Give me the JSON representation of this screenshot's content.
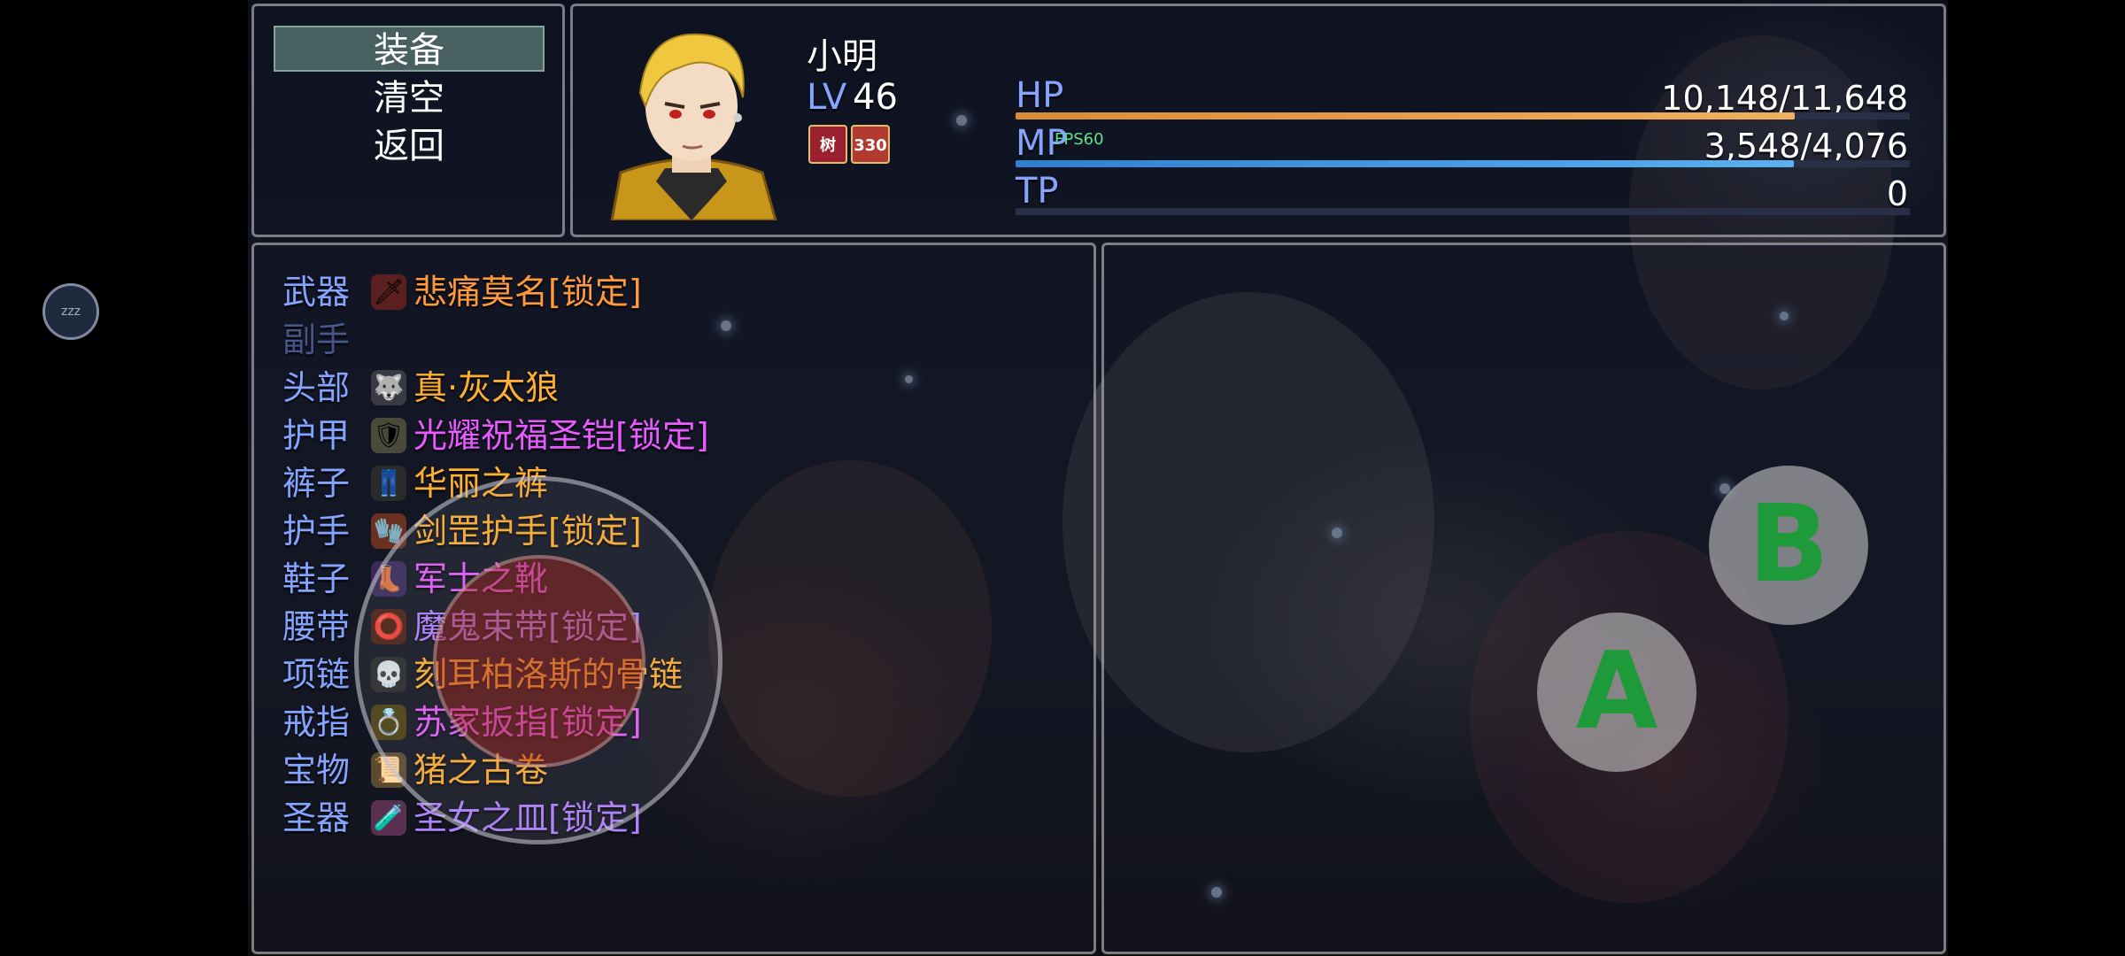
{
  "command_window": {
    "items": [
      {
        "label": "装备",
        "selected": true
      },
      {
        "label": "清空",
        "selected": false
      },
      {
        "label": "返回",
        "selected": false
      }
    ]
  },
  "actor": {
    "name": "小明",
    "level_label": "LV",
    "level": "46",
    "states": [
      {
        "text": "树",
        "icon": "stance-icon"
      },
      {
        "text": "330",
        "icon": "buff-icon"
      }
    ]
  },
  "gauges": {
    "hp": {
      "label": "HP",
      "value_text": "10,148/11,648",
      "current": 10148,
      "max": 11648,
      "color_start": "#d98a3a",
      "color_end": "#f0b060"
    },
    "mp": {
      "label": "MP",
      "value_text": "3,548/4,076",
      "current": 3548,
      "max": 4076,
      "color_start": "#2f7fd0",
      "color_end": "#5ab0f0"
    },
    "tp": {
      "label": "TP",
      "value_text": "0",
      "current": 0,
      "max": 100,
      "color_start": "#3aa060",
      "color_end": "#70d090"
    }
  },
  "fps_text": "FPS60",
  "slots": [
    {
      "label": "武器",
      "item": "悲痛莫名[锁定]",
      "item_color": "#ff9a3c",
      "icon": "sword-icon",
      "icon_glyph": "🗡",
      "icon_bg": "#5a2020",
      "empty": false
    },
    {
      "label": "副手",
      "item": "",
      "item_color": "#ffffff",
      "icon": "",
      "icon_glyph": "",
      "icon_bg": "transparent",
      "empty": true
    },
    {
      "label": "头部",
      "item": "真·灰太狼",
      "item_color": "#ffb030",
      "icon": "wolf-head-icon",
      "icon_glyph": "🐺",
      "icon_bg": "#3a3a44",
      "empty": false
    },
    {
      "label": "护甲",
      "item": "光耀祝福圣铠[锁定]",
      "item_color": "#e85cff",
      "icon": "armor-icon",
      "icon_glyph": "🛡",
      "icon_bg": "#4a4a3a",
      "empty": false
    },
    {
      "label": "裤子",
      "item": "华丽之裤",
      "item_color": "#ffb030",
      "icon": "pants-icon",
      "icon_glyph": "👖",
      "icon_bg": "#2a2a2a",
      "empty": false
    },
    {
      "label": "护手",
      "item": "剑罡护手[锁定]",
      "item_color": "#ffb030",
      "icon": "gauntlet-icon",
      "icon_glyph": "🧤",
      "icon_bg": "#6a3020",
      "empty": false
    },
    {
      "label": "鞋子",
      "item": "军士之靴",
      "item_color": "#e85cff",
      "icon": "boot-icon",
      "icon_glyph": "👢",
      "icon_bg": "#3a2a5a",
      "empty": false
    },
    {
      "label": "腰带",
      "item": "魔鬼束带[锁定]",
      "item_color": "#b080ff",
      "icon": "belt-icon",
      "icon_glyph": "⭕",
      "icon_bg": "#4a2010",
      "empty": false
    },
    {
      "label": "项链",
      "item": "刻耳柏洛斯的骨链",
      "item_color": "#ffb030",
      "icon": "skull-necklace-icon",
      "icon_glyph": "💀",
      "icon_bg": "#2a2a2a",
      "empty": false
    },
    {
      "label": "戒指",
      "item": "苏家扳指[锁定]",
      "item_color": "#e85cff",
      "icon": "ring-icon",
      "icon_glyph": "💍",
      "icon_bg": "#4a4010",
      "empty": false
    },
    {
      "label": "宝物",
      "item": "猪之古卷",
      "item_color": "#ffb030",
      "icon": "scroll-icon",
      "icon_glyph": "📜",
      "icon_bg": "#5a4a30",
      "empty": false
    },
    {
      "label": "圣器",
      "item": "圣女之皿[锁定]",
      "item_color": "#b080ff",
      "icon": "potion-icon",
      "icon_glyph": "🧪",
      "icon_bg": "#5a3050",
      "empty": false
    }
  ],
  "controls": {
    "button_b": "B",
    "button_a": "A",
    "sleep": "zzz"
  }
}
